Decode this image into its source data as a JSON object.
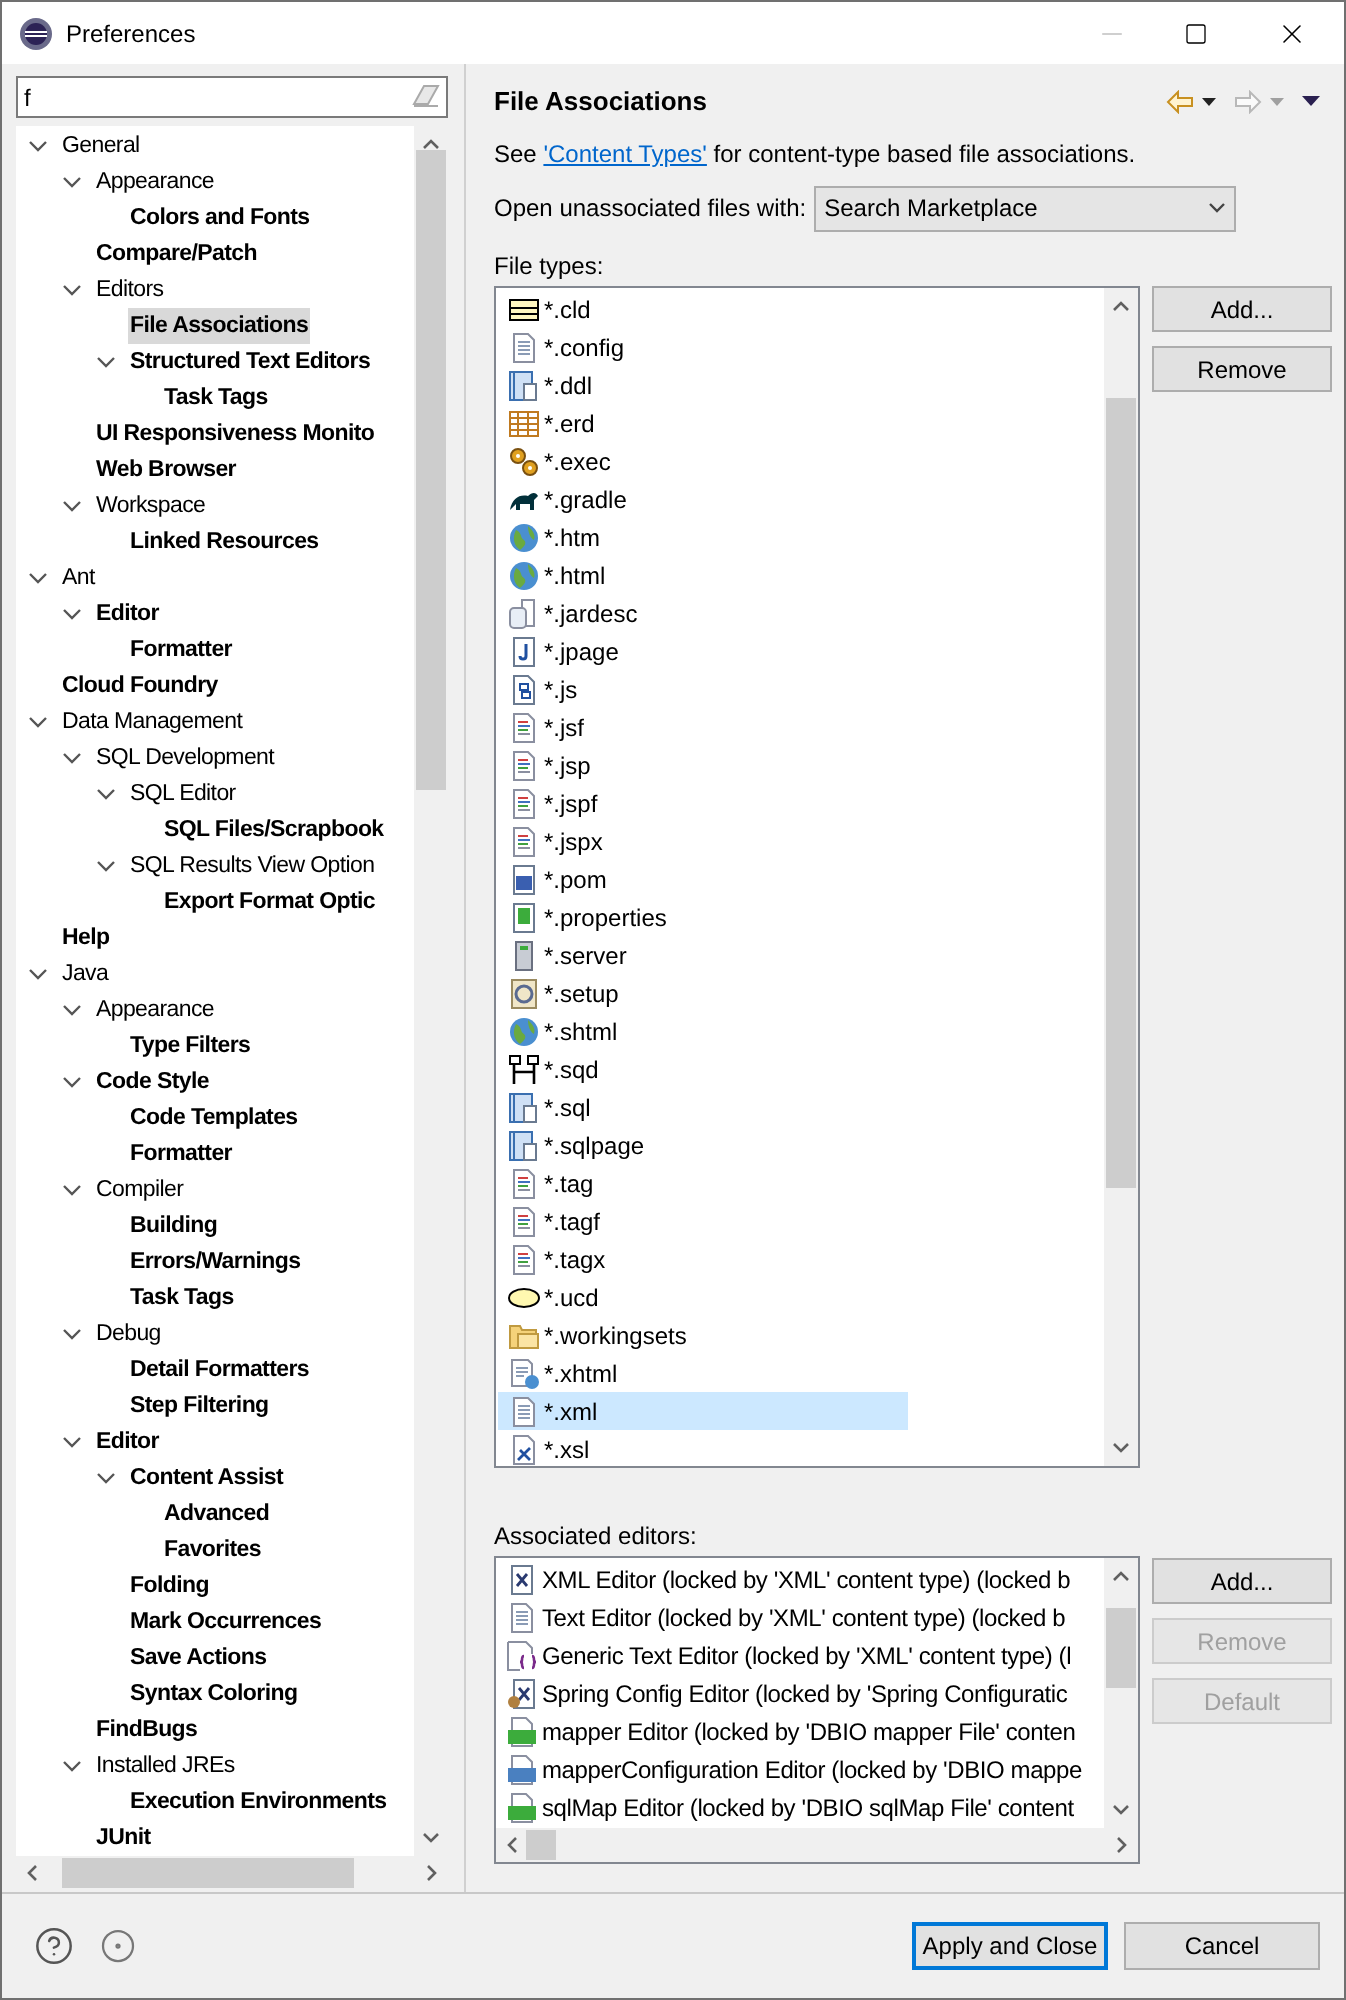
{
  "window": {
    "title": "Preferences"
  },
  "filter": {
    "value": "f"
  },
  "tree": [
    {
      "label": "General",
      "bold": false,
      "selected": false,
      "expanded": true,
      "children": [
        {
          "label": "Appearance",
          "bold": false,
          "selected": false,
          "expanded": true,
          "children": [
            {
              "label": "Colors and Fonts",
              "bold": true,
              "selected": false
            }
          ]
        },
        {
          "label": "Compare/Patch",
          "bold": true,
          "selected": false
        },
        {
          "label": "Editors",
          "bold": false,
          "selected": false,
          "expanded": true,
          "children": [
            {
              "label": "File Associations",
              "bold": true,
              "selected": true
            },
            {
              "label": "Structured Text Editors",
              "bold": true,
              "selected": false,
              "expanded": true,
              "children": [
                {
                  "label": "Task Tags",
                  "bold": true,
                  "selected": false
                }
              ]
            }
          ]
        },
        {
          "label": "UI Responsiveness Monito",
          "bold": true,
          "selected": false
        },
        {
          "label": "Web Browser",
          "bold": true,
          "selected": false
        },
        {
          "label": "Workspace",
          "bold": false,
          "selected": false,
          "expanded": true,
          "children": [
            {
              "label": "Linked Resources",
              "bold": true,
              "selected": false
            }
          ]
        }
      ]
    },
    {
      "label": "Ant",
      "bold": false,
      "selected": false,
      "expanded": true,
      "children": [
        {
          "label": "Editor",
          "bold": true,
          "selected": false,
          "expanded": true,
          "children": [
            {
              "label": "Formatter",
              "bold": true,
              "selected": false
            }
          ]
        }
      ]
    },
    {
      "label": "Cloud Foundry",
      "bold": true,
      "selected": false
    },
    {
      "label": "Data Management",
      "bold": false,
      "selected": false,
      "expanded": true,
      "children": [
        {
          "label": "SQL Development",
          "bold": false,
          "selected": false,
          "expanded": true,
          "children": [
            {
              "label": "SQL Editor",
              "bold": false,
              "selected": false,
              "expanded": true,
              "children": [
                {
                  "label": "SQL Files/Scrapbook",
                  "bold": true,
                  "selected": false
                }
              ]
            },
            {
              "label": "SQL Results View Option",
              "bold": false,
              "selected": false,
              "expanded": true,
              "children": [
                {
                  "label": "Export Format Optic",
                  "bold": true,
                  "selected": false
                }
              ]
            }
          ]
        }
      ]
    },
    {
      "label": "Help",
      "bold": true,
      "selected": false
    },
    {
      "label": "Java",
      "bold": false,
      "selected": false,
      "expanded": true,
      "children": [
        {
          "label": "Appearance",
          "bold": false,
          "selected": false,
          "expanded": true,
          "children": [
            {
              "label": "Type Filters",
              "bold": true,
              "selected": false
            }
          ]
        },
        {
          "label": "Code Style",
          "bold": true,
          "selected": false,
          "expanded": true,
          "children": [
            {
              "label": "Code Templates",
              "bold": true,
              "selected": false
            },
            {
              "label": "Formatter",
              "bold": true,
              "selected": false
            }
          ]
        },
        {
          "label": "Compiler",
          "bold": false,
          "selected": false,
          "expanded": true,
          "children": [
            {
              "label": "Building",
              "bold": true,
              "selected": false
            },
            {
              "label": "Errors/Warnings",
              "bold": true,
              "selected": false
            },
            {
              "label": "Task Tags",
              "bold": true,
              "selected": false
            }
          ]
        },
        {
          "label": "Debug",
          "bold": false,
          "selected": false,
          "expanded": true,
          "children": [
            {
              "label": "Detail Formatters",
              "bold": true,
              "selected": false
            },
            {
              "label": "Step Filtering",
              "bold": true,
              "selected": false
            }
          ]
        },
        {
          "label": "Editor",
          "bold": true,
          "selected": false,
          "expanded": true,
          "children": [
            {
              "label": "Content Assist",
              "bold": true,
              "selected": false,
              "expanded": true,
              "children": [
                {
                  "label": "Advanced",
                  "bold": true,
                  "selected": false
                },
                {
                  "label": "Favorites",
                  "bold": true,
                  "selected": false
                }
              ]
            },
            {
              "label": "Folding",
              "bold": true,
              "selected": false
            },
            {
              "label": "Mark Occurrences",
              "bold": true,
              "selected": false
            },
            {
              "label": "Save Actions",
              "bold": true,
              "selected": false
            },
            {
              "label": "Syntax Coloring",
              "bold": true,
              "selected": false
            }
          ]
        },
        {
          "label": "FindBugs",
          "bold": true,
          "selected": false
        },
        {
          "label": "Installed JREs",
          "bold": false,
          "selected": false,
          "expanded": true,
          "children": [
            {
              "label": "Execution Environments",
              "bold": true,
              "selected": false
            }
          ]
        },
        {
          "label": "JUnit",
          "bold": true,
          "selected": false
        }
      ]
    }
  ],
  "page": {
    "title": "File Associations",
    "intro_before": "See",
    "intro_link": "'Content Types'",
    "intro_after": "for content-type based file associations.",
    "open_label": "Open unassociated files with:",
    "open_value": "Search Marketplace",
    "file_types_label": "File types:",
    "file_types": [
      {
        "label": "*.cld",
        "kind": "form",
        "selected": false
      },
      {
        "label": "*.config",
        "kind": "doc",
        "selected": false
      },
      {
        "label": "*.ddl",
        "kind": "database",
        "selected": false
      },
      {
        "label": "*.erd",
        "kind": "table",
        "selected": false
      },
      {
        "label": "*.exec",
        "kind": "gears",
        "selected": false
      },
      {
        "label": "*.gradle",
        "kind": "elephant",
        "selected": false
      },
      {
        "label": "*.htm",
        "kind": "globe",
        "selected": false
      },
      {
        "label": "*.html",
        "kind": "globe",
        "selected": false
      },
      {
        "label": "*.jardesc",
        "kind": "jar",
        "selected": false
      },
      {
        "label": "*.jpage",
        "kind": "java",
        "selected": false
      },
      {
        "label": "*.js",
        "kind": "script",
        "selected": false
      },
      {
        "label": "*.jsf",
        "kind": "page",
        "selected": false
      },
      {
        "label": "*.jsp",
        "kind": "page",
        "selected": false
      },
      {
        "label": "*.jspf",
        "kind": "page",
        "selected": false
      },
      {
        "label": "*.jspx",
        "kind": "page",
        "selected": false
      },
      {
        "label": "*.pom",
        "kind": "maven",
        "selected": false
      },
      {
        "label": "*.properties",
        "kind": "properties",
        "selected": false
      },
      {
        "label": "*.server",
        "kind": "server",
        "selected": false
      },
      {
        "label": "*.setup",
        "kind": "setup",
        "selected": false
      },
      {
        "label": "*.shtml",
        "kind": "globe",
        "selected": false
      },
      {
        "label": "*.sqd",
        "kind": "diagram",
        "selected": false
      },
      {
        "label": "*.sql",
        "kind": "database",
        "selected": false
      },
      {
        "label": "*.sqlpage",
        "kind": "database",
        "selected": false
      },
      {
        "label": "*.tag",
        "kind": "page",
        "selected": false
      },
      {
        "label": "*.tagf",
        "kind": "page",
        "selected": false
      },
      {
        "label": "*.tagx",
        "kind": "page",
        "selected": false
      },
      {
        "label": "*.ucd",
        "kind": "ellipse",
        "selected": false
      },
      {
        "label": "*.workingsets",
        "kind": "folder",
        "selected": false
      },
      {
        "label": "*.xhtml",
        "kind": "webdoc",
        "selected": false
      },
      {
        "label": "*.xml",
        "kind": "doc",
        "selected": true
      },
      {
        "label": "*.xsl",
        "kind": "xsl",
        "selected": false
      }
    ],
    "file_type_buttons": [
      {
        "label": "Add...",
        "disabled": false
      },
      {
        "label": "Remove",
        "disabled": false
      }
    ],
    "editors_label": "Associated editors:",
    "editors": [
      {
        "label": "XML Editor (locked by 'XML' content type) (locked b",
        "kind": "xml"
      },
      {
        "label": "Text Editor (locked by 'XML' content type) (locked b",
        "kind": "doc"
      },
      {
        "label": "Generic Text Editor (locked by 'XML' content type) (l",
        "kind": "generic"
      },
      {
        "label": "Spring Config Editor (locked by 'Spring Configuratic",
        "kind": "spring"
      },
      {
        "label": "mapper Editor (locked by 'DBIO mapper File' conten",
        "kind": "map"
      },
      {
        "label": "mapperConfiguration Editor (locked by 'DBIO mappe",
        "kind": "cfg"
      },
      {
        "label": "sqlMap Editor (locked by 'DBIO sqlMap File' content",
        "kind": "map"
      }
    ],
    "editor_buttons": [
      {
        "label": "Add...",
        "disabled": false
      },
      {
        "label": "Remove",
        "disabled": true
      },
      {
        "label": "Default",
        "disabled": true
      }
    ]
  },
  "footer": {
    "buttons": [
      {
        "label": "Apply and Close",
        "default": true
      },
      {
        "label": "Cancel",
        "default": false
      }
    ]
  }
}
